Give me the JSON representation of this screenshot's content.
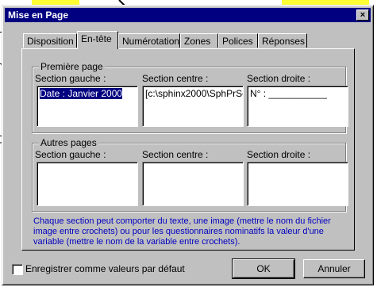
{
  "dialog": {
    "title": "Mise en Page",
    "close_glyph": "×"
  },
  "tabs": [
    {
      "label": "Disposition"
    },
    {
      "label": "En-tête"
    },
    {
      "label": "Numérotation"
    },
    {
      "label": "Zones"
    },
    {
      "label": "Polices"
    },
    {
      "label": "Réponses"
    }
  ],
  "first_page": {
    "group_label": "Première page",
    "left_label": "Section gauche :",
    "center_label": "Section centre :",
    "right_label": "Section droite :",
    "left_value": "Date : Janvier 2000",
    "center_value": "[c:\\sphinx2000\\SphPrSe",
    "right_value": "N° : ___________"
  },
  "other_pages": {
    "group_label": "Autres pages",
    "left_label": "Section gauche :",
    "center_label": "Section centre :",
    "right_label": "Section droite :"
  },
  "info_text": "Chaque section peut comporter du texte, une image (mettre le nom du fichier image entre crochets) ou pour les questionnaires nominatifs la valeur d'une variable (mettre le nom de la variable entre crochets).",
  "footer": {
    "checkbox_label": "Enregistrer comme valeurs par défaut",
    "ok_label": "OK",
    "cancel_label": "Annuler"
  },
  "colors": {
    "titlebar": "#000080",
    "info_text": "#0000c0",
    "background_highlight": "#ffff33"
  }
}
